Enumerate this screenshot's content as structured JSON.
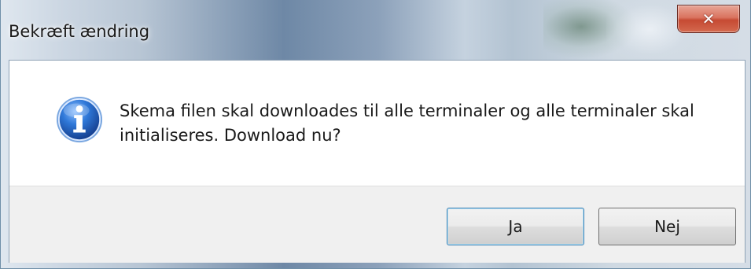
{
  "dialog": {
    "title": "Bekræft ændring",
    "close_icon": "close-icon",
    "message": "Skema filen skal downloades til alle terminaler og alle terminaler skal initialiseres. Download nu?",
    "icon": "info-icon",
    "buttons": {
      "yes": "Ja",
      "no": "Nej"
    }
  },
  "colors": {
    "close_button": "#c64a33",
    "info_icon": "#1f5fbf",
    "footer_background": "#f0f0f0",
    "default_button_border": "#3c7fb1"
  }
}
